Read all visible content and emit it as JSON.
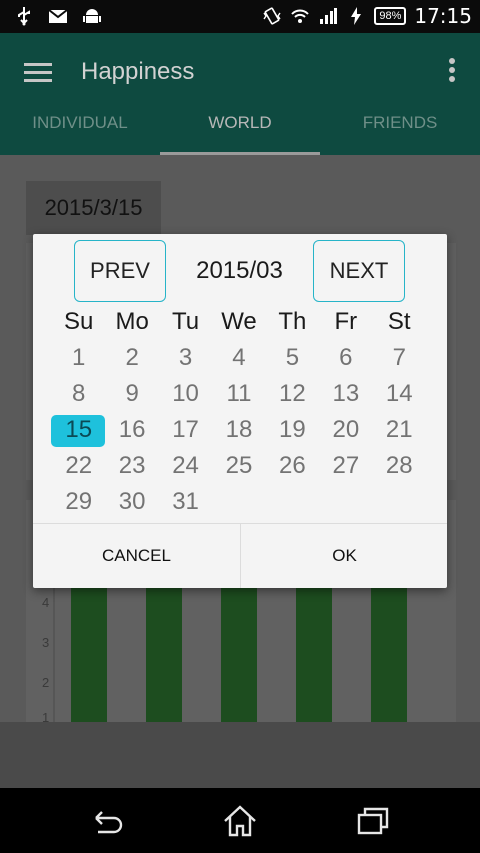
{
  "status_bar": {
    "time": "17:15",
    "battery": "98%"
  },
  "app_bar": {
    "title": "Happiness"
  },
  "tabs": [
    {
      "label": "INDIVIDUAL"
    },
    {
      "label": "WORLD",
      "active": true
    },
    {
      "label": "FRIENDS"
    }
  ],
  "selected_date": "2015/3/15",
  "dialog": {
    "prev_label": "PREV",
    "next_label": "NEXT",
    "month": "2015/03",
    "weekdays": [
      "Su",
      "Mo",
      "Tu",
      "We",
      "Th",
      "Fr",
      "St"
    ],
    "weeks": [
      [
        "1",
        "2",
        "3",
        "4",
        "5",
        "6",
        "7"
      ],
      [
        "8",
        "9",
        "10",
        "11",
        "12",
        "13",
        "14"
      ],
      [
        "15",
        "16",
        "17",
        "18",
        "19",
        "20",
        "21"
      ],
      [
        "22",
        "23",
        "24",
        "25",
        "26",
        "27",
        "28"
      ],
      [
        "29",
        "30",
        "31",
        "",
        "",
        "",
        ""
      ]
    ],
    "selected_day": "15",
    "cancel_label": "CANCEL",
    "ok_label": "OK"
  },
  "colors": {
    "accent": "#1ec1dc",
    "app_bar": "#00897b",
    "bar_green": "#2e7d32"
  },
  "chart_data": {
    "type": "bar",
    "y_ticks": [
      "4",
      "3",
      "2",
      "1"
    ],
    "bar_count": 5
  },
  "nav": {
    "icons": [
      "back-icon",
      "home-icon",
      "recent-apps-icon"
    ]
  }
}
